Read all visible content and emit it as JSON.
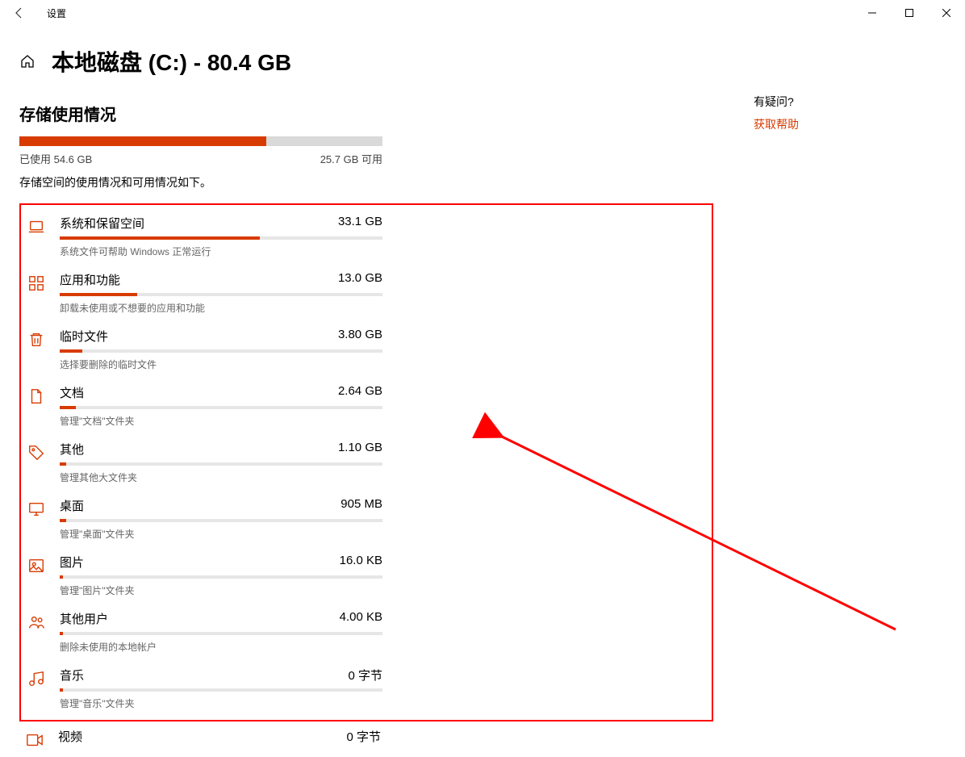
{
  "window": {
    "app_title": "设置"
  },
  "header": {
    "page_title": "本地磁盘 (C:) - 80.4 GB"
  },
  "storage": {
    "section_title": "存储使用情况",
    "used_label": "已使用 54.6 GB",
    "free_label": "25.7 GB 可用",
    "used_pct": 68,
    "desc": "存储空间的使用情况和可用情况如下。"
  },
  "categories": [
    {
      "icon": "laptop",
      "name": "系统和保留空间",
      "size": "33.1 GB",
      "pct": 62,
      "sub": "系统文件可帮助 Windows 正常运行"
    },
    {
      "icon": "apps",
      "name": "应用和功能",
      "size": "13.0 GB",
      "pct": 24,
      "sub": "卸载未使用或不想要的应用和功能"
    },
    {
      "icon": "trash",
      "name": "临时文件",
      "size": "3.80 GB",
      "pct": 7,
      "sub": "选择要删除的临时文件"
    },
    {
      "icon": "document",
      "name": "文档",
      "size": "2.64 GB",
      "pct": 5,
      "sub": "管理\"文档\"文件夹"
    },
    {
      "icon": "tag",
      "name": "其他",
      "size": "1.10 GB",
      "pct": 2,
      "sub": "管理其他大文件夹"
    },
    {
      "icon": "desktop",
      "name": "桌面",
      "size": "905 MB",
      "pct": 2,
      "sub": "管理\"桌面\"文件夹"
    },
    {
      "icon": "picture",
      "name": "图片",
      "size": "16.0 KB",
      "pct": 1,
      "sub": "管理\"图片\"文件夹"
    },
    {
      "icon": "users",
      "name": "其他用户",
      "size": "4.00 KB",
      "pct": 1,
      "sub": "删除未使用的本地帐户"
    },
    {
      "icon": "music",
      "name": "音乐",
      "size": "0 字节",
      "pct": 1,
      "sub": "管理\"音乐\"文件夹"
    }
  ],
  "extra_category": {
    "icon": "video",
    "name": "视频",
    "size": "0 字节",
    "pct": 1
  },
  "side": {
    "question": "有疑问?",
    "help_link": "获取帮助"
  },
  "accent": "#d83b01"
}
